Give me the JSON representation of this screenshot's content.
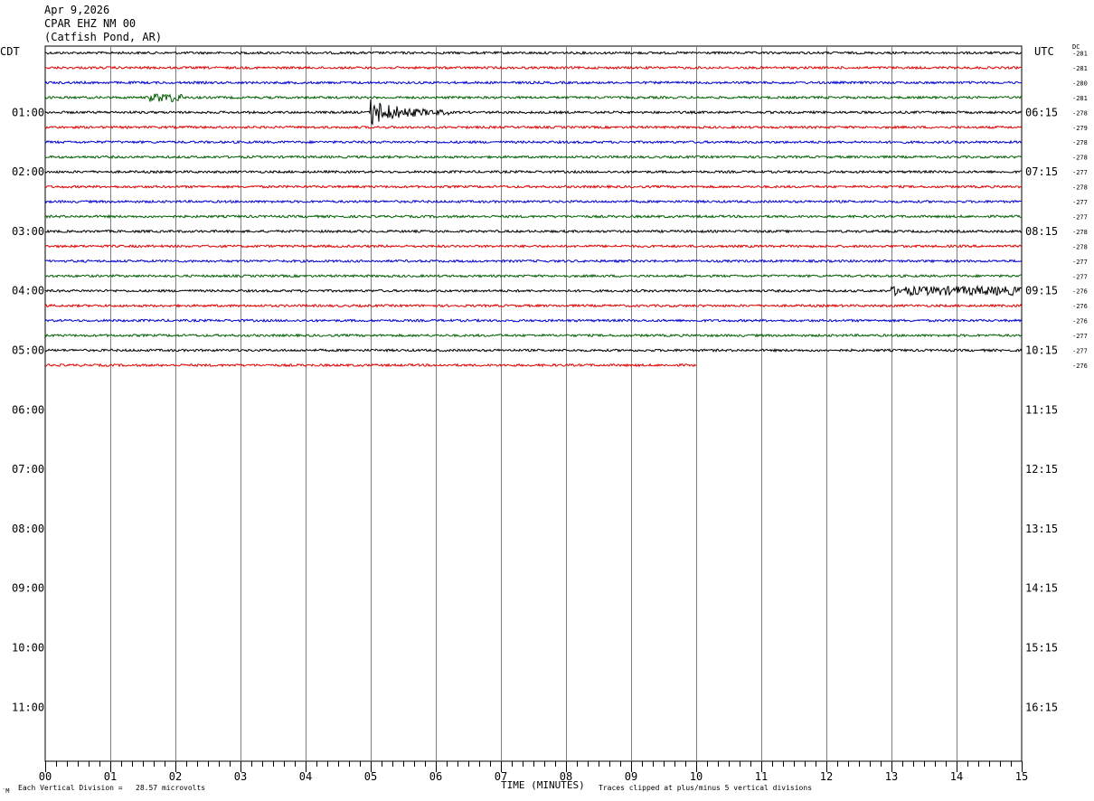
{
  "header": {
    "date": "Apr 9,2026",
    "station": "CPAR EHZ NM 00",
    "location": "(Catfish Pond, AR)"
  },
  "axes": {
    "left_tz": "CDT",
    "right_tz": "UTC",
    "dc_label": "DC",
    "xlabel": "TIME (MINUTES)"
  },
  "notes": {
    "scale": "Each Vertical Division =   28.57 microvolts",
    "clip": "Traces clipped at plus/minus 5 vertical divisions",
    "corner": "′M"
  },
  "colors": {
    "trace_cycle": [
      "#000000",
      "#e00000",
      "#0000d0",
      "#006000"
    ],
    "grid": "#808080"
  },
  "chart_data": {
    "type": "seismogram",
    "title": "CPAR EHZ NM 00",
    "xlabel": "TIME (MINUTES)",
    "x_ticks": [
      "00",
      "01",
      "02",
      "03",
      "04",
      "05",
      "06",
      "07",
      "08",
      "09",
      "10",
      "11",
      "12",
      "13",
      "14",
      "15"
    ],
    "xlim": [
      0,
      15
    ],
    "minutes_per_line": 15,
    "left_hour_labels": [
      "01:00",
      "02:00",
      "03:00",
      "04:00",
      "05:00",
      "06:00",
      "07:00",
      "08:00",
      "09:00",
      "10:00",
      "11:00"
    ],
    "right_hour_labels": [
      "06:15",
      "07:15",
      "08:15",
      "09:15",
      "10:15",
      "11:15",
      "12:15",
      "13:15",
      "14:15",
      "15:15",
      "16:15"
    ],
    "total_lines": 48,
    "dc_offsets": [
      "-281",
      "-281",
      "-280",
      "-281",
      "-278",
      "-279",
      "-278",
      "-278",
      "-277",
      "-278",
      "-277",
      "-277",
      "-278",
      "-278",
      "-277",
      "-277",
      "-276",
      "-276",
      "-276",
      "-277",
      "-277",
      "-276"
    ],
    "last_line_end_minute": 10,
    "events": [
      {
        "line": 3,
        "start_min": 1.6,
        "end_min": 2.1,
        "amplitude": "moderate"
      },
      {
        "line": 4,
        "start_min": 5.0,
        "end_min": 6.2,
        "amplitude": "large"
      },
      {
        "line": 16,
        "start_min": 13.0,
        "end_min": 15.0,
        "amplitude": "moderate"
      }
    ]
  }
}
